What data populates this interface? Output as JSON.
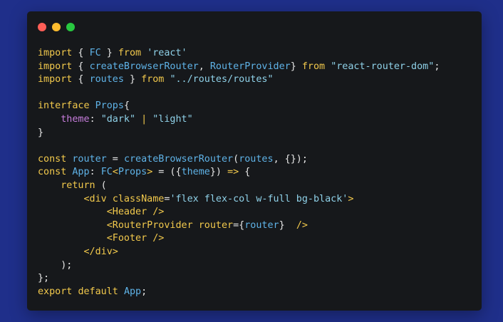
{
  "window": {
    "dots": [
      {
        "name": "close-dot",
        "color": "#ff5f57"
      },
      {
        "name": "minimize-dot",
        "color": "#febc2e"
      },
      {
        "name": "maximize-dot",
        "color": "#28c840"
      }
    ]
  },
  "colors": {
    "kw": "#f2c94c",
    "type": "#5fb3e8",
    "str": "#8fd1e8",
    "prop": "#c77ddc",
    "tag": "#f2c94c",
    "text": "#e6e6e6"
  },
  "code_lines": [
    [
      [
        "kw",
        "import"
      ],
      [
        "text",
        " { "
      ],
      [
        "type",
        "FC"
      ],
      [
        "text",
        " } "
      ],
      [
        "kw",
        "from"
      ],
      [
        "text",
        " "
      ],
      [
        "str",
        "'react'"
      ]
    ],
    [
      [
        "kw",
        "import"
      ],
      [
        "text",
        " { "
      ],
      [
        "type",
        "createBrowserRouter"
      ],
      [
        "text",
        ", "
      ],
      [
        "type",
        "RouterProvider"
      ],
      [
        "text",
        "} "
      ],
      [
        "kw",
        "from"
      ],
      [
        "text",
        " "
      ],
      [
        "str",
        "\"react-router-dom\""
      ],
      [
        "text",
        ";"
      ]
    ],
    [
      [
        "kw",
        "import"
      ],
      [
        "text",
        " { "
      ],
      [
        "type",
        "routes"
      ],
      [
        "text",
        " } "
      ],
      [
        "kw",
        "from"
      ],
      [
        "text",
        " "
      ],
      [
        "str",
        "\"../routes/routes\""
      ]
    ],
    [],
    [
      [
        "kw",
        "interface"
      ],
      [
        "text",
        " "
      ],
      [
        "type",
        "Props"
      ],
      [
        "text",
        "{"
      ]
    ],
    [
      [
        "text",
        "    "
      ],
      [
        "prop",
        "theme"
      ],
      [
        "text",
        ": "
      ],
      [
        "str",
        "\"dark\""
      ],
      [
        "text",
        " "
      ],
      [
        "kw",
        "|"
      ],
      [
        "text",
        " "
      ],
      [
        "str",
        "\"light\""
      ]
    ],
    [
      [
        "text",
        "}"
      ]
    ],
    [],
    [
      [
        "kw",
        "const"
      ],
      [
        "text",
        " "
      ],
      [
        "type",
        "router"
      ],
      [
        "text",
        " = "
      ],
      [
        "type",
        "createBrowserRouter"
      ],
      [
        "text",
        "("
      ],
      [
        "type",
        "routes"
      ],
      [
        "text",
        ", {});"
      ]
    ],
    [
      [
        "kw",
        "const"
      ],
      [
        "text",
        " "
      ],
      [
        "type",
        "App"
      ],
      [
        "text",
        ": "
      ],
      [
        "type",
        "FC"
      ],
      [
        "tag",
        "<"
      ],
      [
        "type",
        "Props"
      ],
      [
        "tag",
        ">"
      ],
      [
        "text",
        " = ({"
      ],
      [
        "type",
        "theme"
      ],
      [
        "text",
        "}) "
      ],
      [
        "kw",
        "=>"
      ],
      [
        "text",
        " {"
      ]
    ],
    [
      [
        "text",
        "    "
      ],
      [
        "kw",
        "return"
      ],
      [
        "text",
        " ("
      ]
    ],
    [
      [
        "text",
        "        "
      ],
      [
        "tag",
        "<div"
      ],
      [
        "text",
        " "
      ],
      [
        "kw",
        "className"
      ],
      [
        "text",
        "="
      ],
      [
        "str",
        "'flex flex-col w-full bg-black'"
      ],
      [
        "tag",
        ">"
      ]
    ],
    [
      [
        "text",
        "            "
      ],
      [
        "tag",
        "<Header />"
      ]
    ],
    [
      [
        "text",
        "            "
      ],
      [
        "tag",
        "<RouterProvider"
      ],
      [
        "text",
        " "
      ],
      [
        "kw",
        "router"
      ],
      [
        "text",
        "={"
      ],
      [
        "type",
        "router"
      ],
      [
        "text",
        "}  "
      ],
      [
        "tag",
        "/>"
      ]
    ],
    [
      [
        "text",
        "            "
      ],
      [
        "tag",
        "<Footer />"
      ]
    ],
    [
      [
        "text",
        "        "
      ],
      [
        "tag",
        "</div>"
      ]
    ],
    [
      [
        "text",
        "    );"
      ]
    ],
    [
      [
        "text",
        "};"
      ]
    ],
    [
      [
        "kw",
        "export"
      ],
      [
        "text",
        " "
      ],
      [
        "kw",
        "default"
      ],
      [
        "text",
        " "
      ],
      [
        "type",
        "App"
      ],
      [
        "text",
        ";"
      ]
    ]
  ]
}
